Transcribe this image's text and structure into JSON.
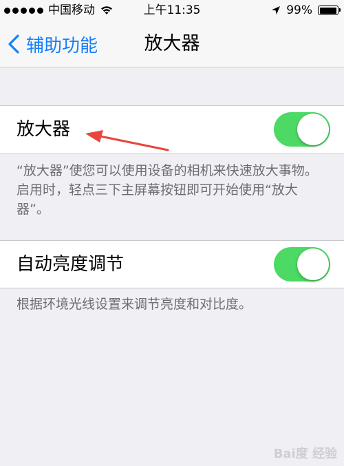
{
  "status_bar": {
    "carrier": "中国移动",
    "time": "上午11:35",
    "battery_percent": "99%",
    "battery_level": 0.99
  },
  "nav": {
    "back_label": "辅助功能",
    "title": "放大器"
  },
  "settings": [
    {
      "label": "放大器",
      "enabled": true,
      "footer": "“放大器”使您可以使用设备的相机来快速放大事物。启用时，轻点三下主屏幕按钮即可开始使用“放大器”。"
    },
    {
      "label": "自动亮度调节",
      "enabled": true,
      "footer": "根据环境光线设置来调节亮度和对比度。"
    }
  ],
  "colors": {
    "toggle_on": "#4cd964",
    "ios_blue": "#157efb",
    "annotation_arrow": "#e8453c"
  },
  "watermark": "Bai度 经验"
}
